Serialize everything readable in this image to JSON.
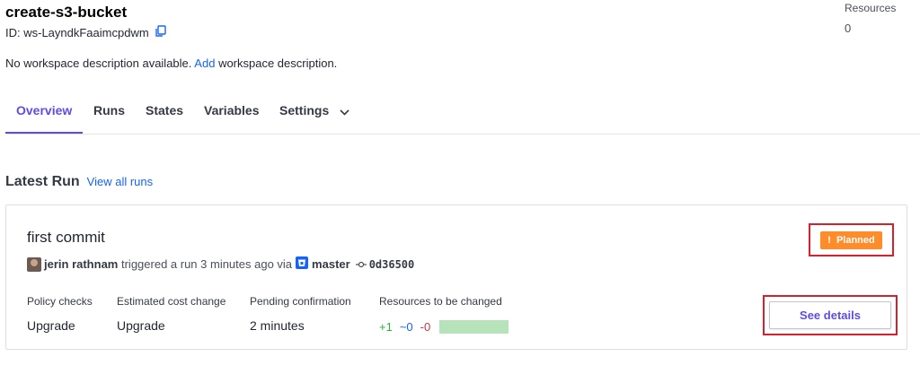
{
  "workspace": {
    "title": "create-s3-bucket",
    "id_label": "ID: ws-LayndkFaaimcpdwm",
    "description_text": "No workspace description available.",
    "description_link": "Add",
    "description_suffix": "workspace description."
  },
  "resources": {
    "label": "Resources",
    "count": "0"
  },
  "tabs": [
    {
      "label": "Overview",
      "active": true
    },
    {
      "label": "Runs"
    },
    {
      "label": "States"
    },
    {
      "label": "Variables"
    },
    {
      "label": "Settings"
    }
  ],
  "latest_run": {
    "heading": "Latest Run",
    "view_all": "View all runs",
    "commit_message": "first commit",
    "user": "jerin rathnam",
    "action": "triggered a run 3 minutes ago via",
    "branch": "master",
    "sha": "0d36500",
    "status": "Planned",
    "status_icon": "exclamation-icon",
    "colors": {
      "status": "#ff8c2a",
      "add": "#2eb039",
      "change": "#1563ff",
      "destroy": "#c73445",
      "accent": "#5c4ee5"
    },
    "columns": {
      "policy": {
        "label": "Policy checks",
        "value": "Upgrade"
      },
      "cost": {
        "label": "Estimated cost change",
        "value": "Upgrade"
      },
      "pending": {
        "label": "Pending confirmation",
        "value": "2 minutes"
      },
      "resources": {
        "label": "Resources to be changed",
        "add": "+1",
        "change": "~0",
        "destroy": "-0"
      }
    },
    "see_details": "See details"
  }
}
